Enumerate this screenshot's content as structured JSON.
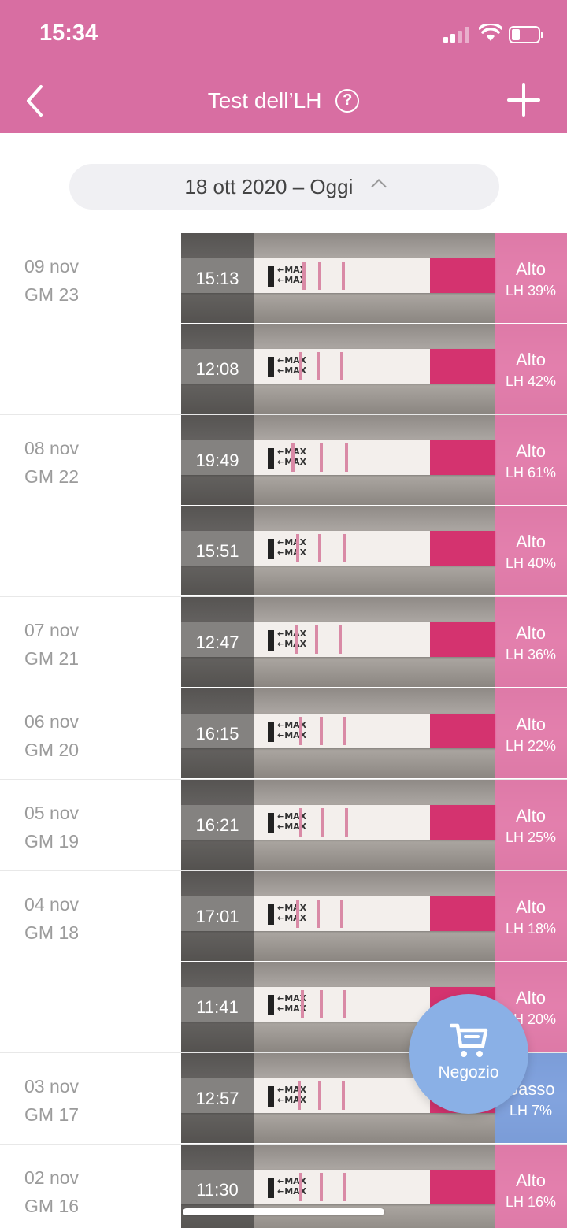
{
  "status_bar": {
    "time": "15:34"
  },
  "nav": {
    "title": "Test dell’LH",
    "help_icon": "?",
    "back_icon": "chevron-left-icon",
    "add_icon": "plus-icon"
  },
  "range": {
    "label": "18 ott 2020 – Oggi"
  },
  "colors": {
    "header": "#d86ea2",
    "high": "#e878ac",
    "low": "#78a0e6",
    "fab": "#8ab0e6"
  },
  "groups": [
    {
      "date": "09 nov",
      "cycle_day": "GM 23",
      "tests": [
        {
          "time": "15:13",
          "level": "Alto",
          "lh": "LH 39%"
        },
        {
          "time": "12:08",
          "level": "Alto",
          "lh": "LH 42%"
        }
      ]
    },
    {
      "date": "08 nov",
      "cycle_day": "GM 22",
      "tests": [
        {
          "time": "19:49",
          "level": "Alto",
          "lh": "LH 61%"
        },
        {
          "time": "15:51",
          "level": "Alto",
          "lh": "LH 40%"
        }
      ]
    },
    {
      "date": "07 nov",
      "cycle_day": "GM 21",
      "tests": [
        {
          "time": "12:47",
          "level": "Alto",
          "lh": "LH 36%"
        }
      ]
    },
    {
      "date": "06 nov",
      "cycle_day": "GM 20",
      "tests": [
        {
          "time": "16:15",
          "level": "Alto",
          "lh": "LH 22%"
        }
      ]
    },
    {
      "date": "05 nov",
      "cycle_day": "GM 19",
      "tests": [
        {
          "time": "16:21",
          "level": "Alto",
          "lh": "LH 25%"
        }
      ]
    },
    {
      "date": "04 nov",
      "cycle_day": "GM 18",
      "tests": [
        {
          "time": "17:01",
          "level": "Alto",
          "lh": "LH 18%"
        },
        {
          "time": "11:41",
          "level": "Alto",
          "lh": "LH 20%"
        }
      ]
    },
    {
      "date": "03 nov",
      "cycle_day": "GM 17",
      "tests": [
        {
          "time": "12:57",
          "level": "Basso",
          "lh": "LH 7%"
        }
      ]
    },
    {
      "date": "02 nov",
      "cycle_day": "GM 16",
      "tests": [
        {
          "time": "11:30",
          "level": "Alto",
          "lh": "LH 16%"
        }
      ]
    }
  ],
  "strip_marker": "MAX",
  "fab": {
    "label": "Negozio",
    "icon": "shopping-cart-icon"
  }
}
